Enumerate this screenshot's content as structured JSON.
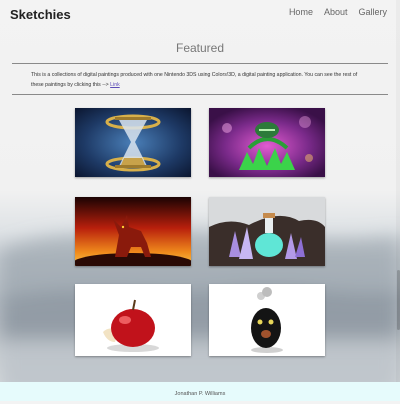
{
  "header": {
    "brand": "Sketchies",
    "nav": [
      {
        "label": "Home"
      },
      {
        "label": "About"
      },
      {
        "label": "Gallery"
      }
    ]
  },
  "main": {
    "title": "Featured",
    "intro_text": "This is a collections of digital paintings produced with one Nintendo 3DS using Colors!3D, a digital painting application. You can see the rest of these paintings by clicking this --> ",
    "intro_link": "Link"
  },
  "gallery": {
    "items": [
      {
        "subject": "hourglass"
      },
      {
        "subject": "jack-o-lantern"
      },
      {
        "subject": "red-wolf"
      },
      {
        "subject": "crystal-potion"
      },
      {
        "subject": "red-apple"
      },
      {
        "subject": "black-creature"
      }
    ]
  },
  "footer": {
    "author": "Jonathan P. Williams"
  }
}
